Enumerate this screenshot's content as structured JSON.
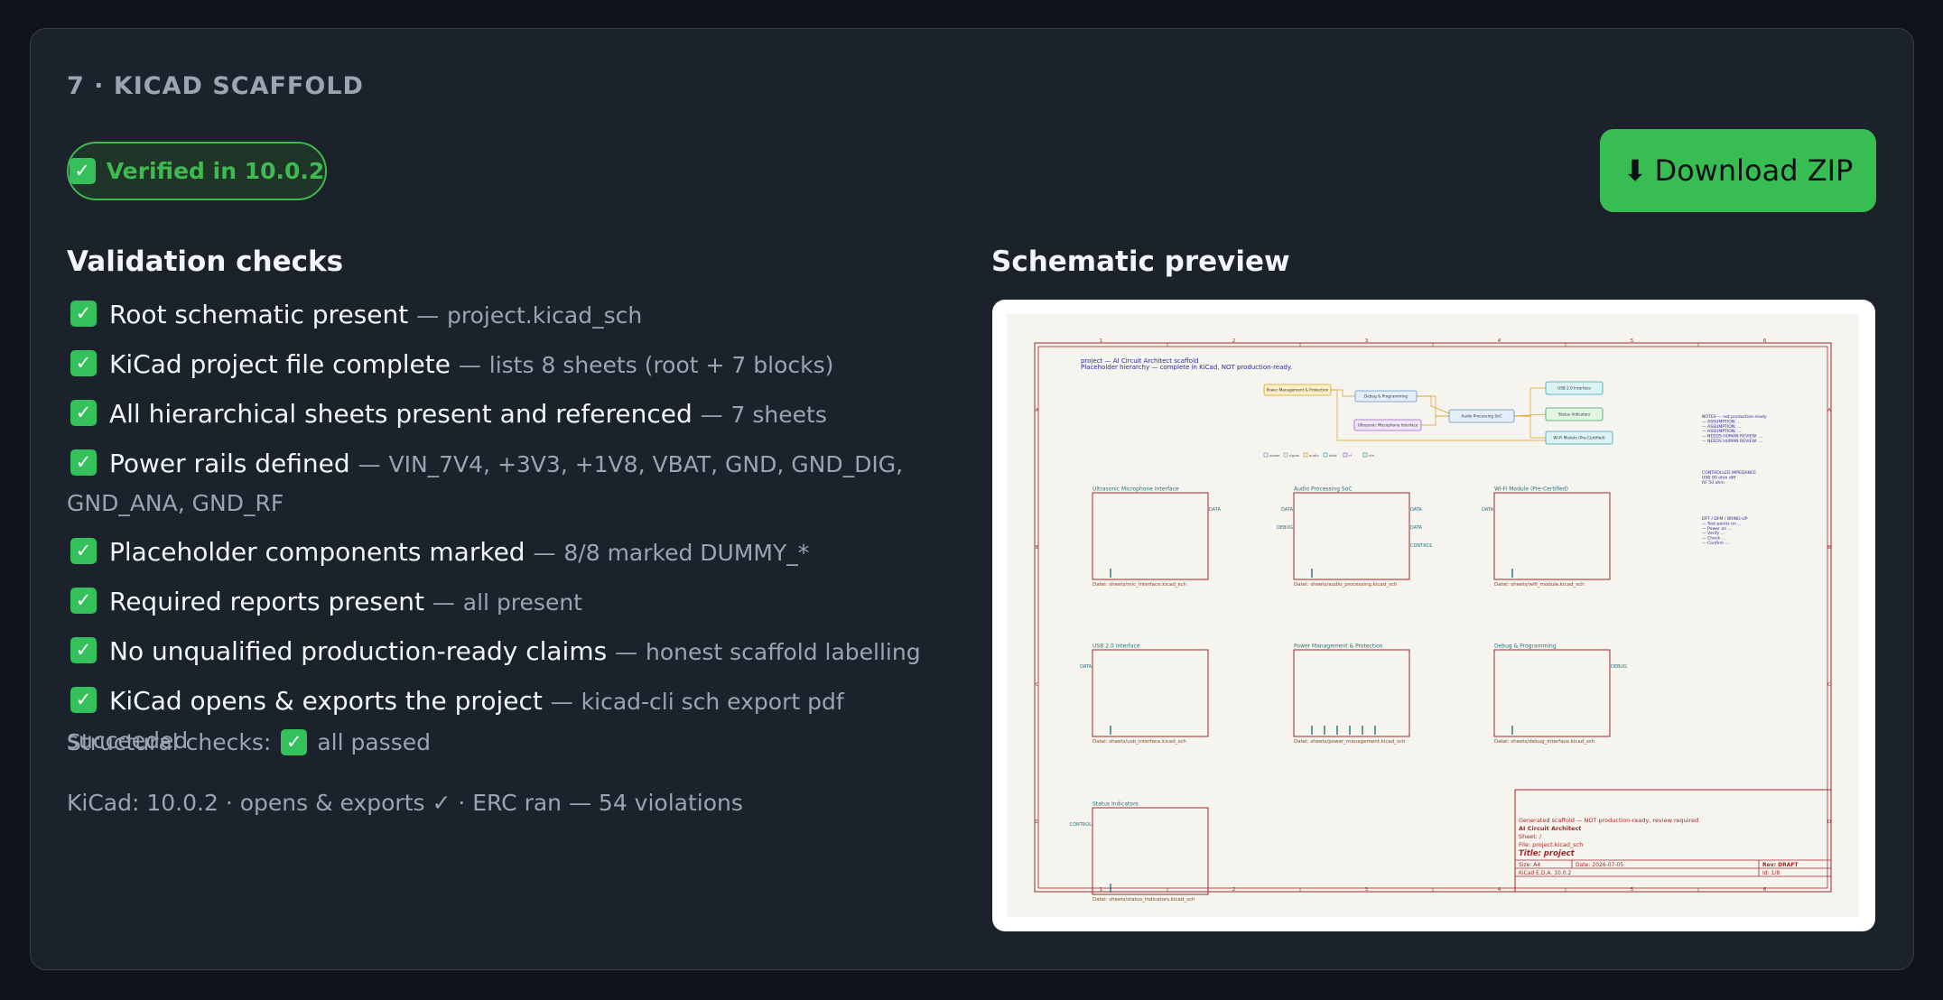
{
  "section": {
    "title": "7 · KICAD SCAFFOLD",
    "badge": {
      "icon": "check-box-icon",
      "text": "Verified in 10.0.2"
    },
    "download": {
      "icon": "download-arrow-icon",
      "glyph": "⬇",
      "label": "Download ZIP"
    }
  },
  "validation": {
    "heading": "Validation checks",
    "items": [
      {
        "label": "Root schematic present",
        "detail": "project.kicad_sch"
      },
      {
        "label": "KiCad project file complete",
        "detail": "lists 8 sheets (root + 7 blocks)"
      },
      {
        "label": "All hierarchical sheets present and referenced",
        "detail": "7 sheets"
      },
      {
        "label": "Power rails defined",
        "detail": "VIN_7V4, +3V3, +1V8, VBAT, GND, GND_DIG, GND_ANA, GND_RF"
      },
      {
        "label": "Placeholder components marked",
        "detail": "8/8 marked DUMMY_*"
      },
      {
        "label": "Required reports present",
        "detail": "all present"
      },
      {
        "label": "No unqualified production-ready claims",
        "detail": "honest scaffold labelling"
      },
      {
        "label": "KiCad opens & exports the project",
        "detail": "kicad-cli sch export pdf succeeded"
      }
    ],
    "separator": "—",
    "structural_label": "Structural checks:",
    "structural_value": "all passed",
    "kicad_summary": "KiCad: 10.0.2 · opens & exports ✓ · ERC ran — 54 violations"
  },
  "preview": {
    "heading": "Schematic preview",
    "schematic": {
      "header_line1": "project — AI Circuit Architect scaffold",
      "header_line2": "Placeholder hierarchy — complete in KiCad, NOT production-ready.",
      "column_numbers": [
        "1",
        "2",
        "3",
        "4",
        "5",
        "6"
      ],
      "row_letters": [
        "A",
        "B",
        "C",
        "D"
      ],
      "diagram_blocks": [
        "Power Management & Protection",
        "Debug & Programming",
        "USB 2.0 Interface",
        "Audio Processing SoC",
        "Status Indicators",
        "Ultrasonic Microphone Interface",
        "Wi-Fi Module (Pre-Certified)"
      ],
      "legend": [
        "power",
        "signal",
        "audio",
        "data",
        "rf",
        "ctrl"
      ],
      "sheets": [
        {
          "title": "Ultrasonic Microphone Interface",
          "file": "Datei: sheets/mic_interface.kicad_sch",
          "pins": [
            "DATA"
          ]
        },
        {
          "title": "Audio Processing SoC",
          "file": "Datei: sheets/audio_processing.kicad_sch",
          "pins": [
            "DATA",
            "DEBUG",
            "DATA",
            "DATA",
            "CONTROL"
          ]
        },
        {
          "title": "Wi-Fi Module (Pre-Certified)",
          "file": "Datei: sheets/wifi_module.kicad_sch",
          "pins": [
            "DATA"
          ]
        },
        {
          "title": "USB 2.0 Interface",
          "file": "Datei: sheets/usb_interface.kicad_sch",
          "pins": [
            "DATA"
          ]
        },
        {
          "title": "Power Management & Protection",
          "file": "Datei: sheets/power_management.kicad_sch",
          "pins": []
        },
        {
          "title": "Debug & Programming",
          "file": "Datei: sheets/debug_interface.kicad_sch",
          "pins": [
            "DEBUG"
          ]
        },
        {
          "title": "Status Indicators",
          "file": "Datei: sheets/status_indicators.kicad_sch",
          "pins": [
            "CONTROL"
          ]
        }
      ],
      "notes": [
        "NOTES — not production-ready",
        "— ASSUMPTION: ...",
        "— ASSUMPTION: ...",
        "— ASSUMPTION: ...",
        "— NEEDS HUMAN REVIEW: ...",
        "— NEEDS HUMAN REVIEW: ..."
      ],
      "impedance": [
        "CONTROLLED IMPEDANCE",
        "USB 90 ohm diff",
        "RF 50 ohm"
      ],
      "bringup": [
        "DFT / DFM / BRING-UP",
        "— Test points on ...",
        "— Power on ...",
        "— Verify ...",
        "— Check ...",
        "— Confirm ..."
      ],
      "title_block": {
        "generated": "Generated scaffold — NOT production-ready, review required",
        "company": "AI Circuit Architect",
        "sheet": "Sheet: /",
        "file": "File: project.kicad_sch",
        "title": "Title: project",
        "size": "Size: A4",
        "date": "Date: 2026-07-05",
        "rev": "Rev: DRAFT",
        "tool": "KiCad E.D.A. 10.0.2",
        "id": "Id: 1/8"
      }
    }
  },
  "colors": {
    "success": "#3fb950",
    "button": "#38bd52",
    "card": "#1c222b",
    "sheet_border": "#a62626",
    "schematic_bg": "#f5f4ef"
  }
}
